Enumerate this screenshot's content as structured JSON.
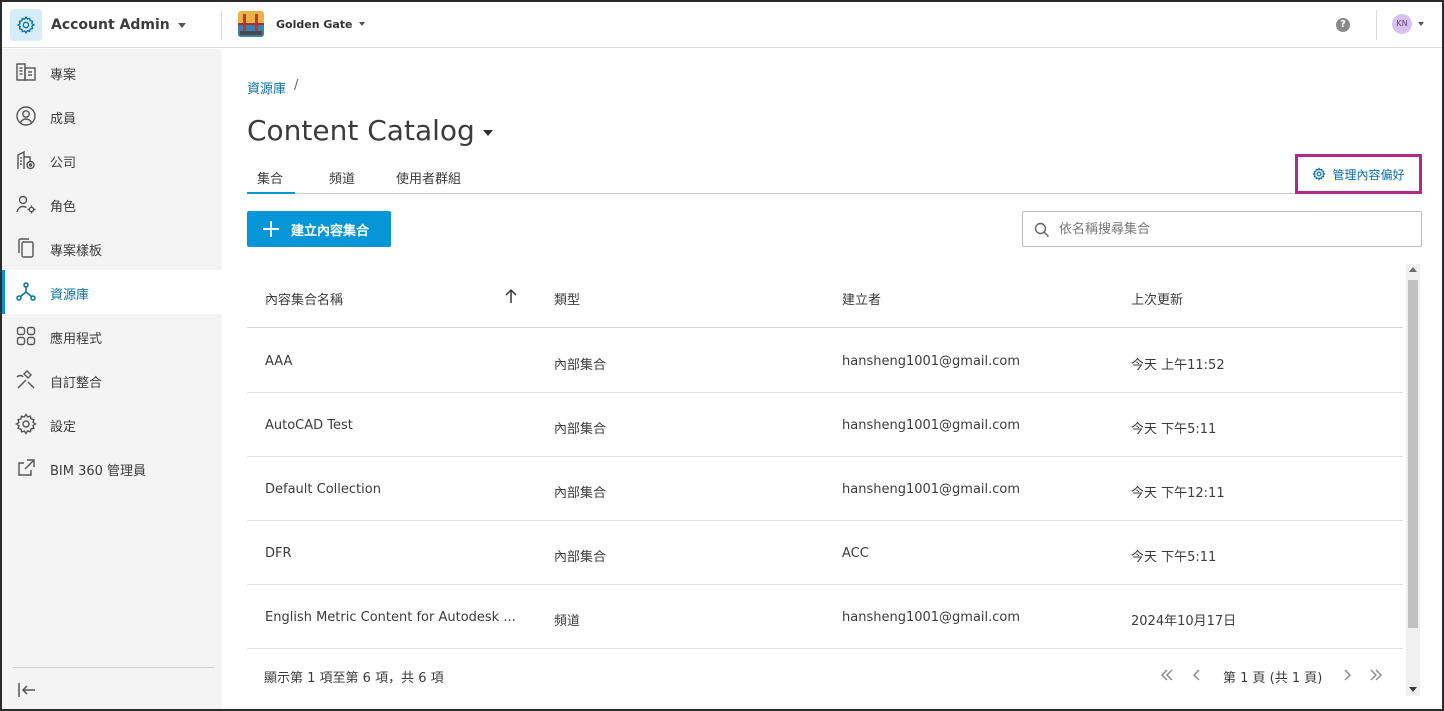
{
  "colors": {
    "accent": "#0696d7",
    "link": "#0a6ea8",
    "highlight_border": "#b02a8a",
    "sidebar_bg": "#f4f4f4"
  },
  "topbar": {
    "app_title": "Account Admin",
    "app_icon": "gear-icon",
    "project_name": "Golden Gate",
    "help_icon": "help-icon",
    "user_initials": "KN"
  },
  "sidebar": {
    "items": [
      {
        "label": "專案",
        "icon": "building-icon"
      },
      {
        "label": "成員",
        "icon": "user-circle-icon"
      },
      {
        "label": "公司",
        "icon": "company-icon"
      },
      {
        "label": "角色",
        "icon": "user-gear-icon"
      },
      {
        "label": "專案樣板",
        "icon": "copy-icon"
      },
      {
        "label": "資源庫",
        "icon": "hub-icon",
        "active": true
      },
      {
        "label": "應用程式",
        "icon": "apps-grid-icon"
      },
      {
        "label": "自訂整合",
        "icon": "tools-icon"
      },
      {
        "label": "設定",
        "icon": "gear-icon"
      },
      {
        "label": "BIM 360 管理員",
        "icon": "external-link-icon"
      }
    ],
    "collapse_icon": "collapse-left-icon"
  },
  "main": {
    "breadcrumb": {
      "link": "資源庫",
      "separator": "/"
    },
    "title": "Content Catalog",
    "tabs": [
      {
        "label": "集合",
        "active": true
      },
      {
        "label": "頻道"
      },
      {
        "label": "使用者群組"
      }
    ],
    "manage_button": "管理內容偏好",
    "create_button": "建立內容集合",
    "search": {
      "placeholder": "依名稱搜尋集合",
      "value": ""
    }
  },
  "table": {
    "columns": [
      "內容集合名稱",
      "類型",
      "建立者",
      "上次更新"
    ],
    "sort": {
      "column": "內容集合名稱",
      "direction": "ascending"
    },
    "rows": [
      {
        "name": "AAA",
        "type": "內部集合",
        "creator": "hansheng1001@gmail.com",
        "updated": "今天 上午11:52"
      },
      {
        "name": "AutoCAD Test",
        "type": "內部集合",
        "creator": "hansheng1001@gmail.com",
        "updated": "今天 下午5:11"
      },
      {
        "name": "Default Collection",
        "type": "內部集合",
        "creator": "hansheng1001@gmail.com",
        "updated": "今天 下午12:11"
      },
      {
        "name": "DFR",
        "type": "內部集合",
        "creator": "ACC",
        "updated": "今天 下午5:11"
      },
      {
        "name": "English Metric Content for Autodesk ...",
        "type": "頻道",
        "creator": "hansheng1001@gmail.com",
        "updated": "2024年10月17日"
      }
    ]
  },
  "pager": {
    "info": "顯示第 1 項至第 6 項，共 6 項",
    "page": "第 1 頁 (共 1 頁)"
  }
}
